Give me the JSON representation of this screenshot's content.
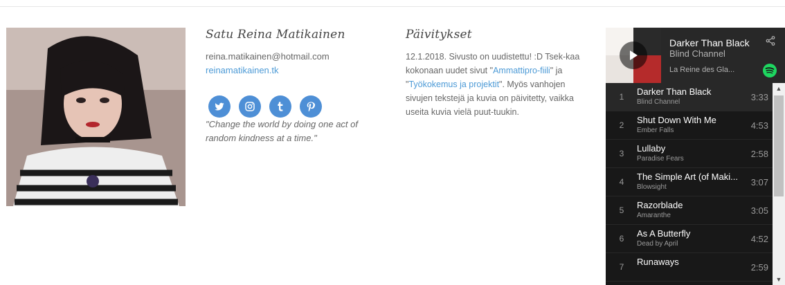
{
  "profile": {
    "name": "Satu Reina Matikainen",
    "email": "reina.matikainen@hotmail.com",
    "website": "reinamatikainen.tk",
    "quote": "\"Change the world by doing one act of random kindness at a time.\"",
    "social": [
      "twitter-icon",
      "instagram-icon",
      "tumblr-icon",
      "pinterest-icon"
    ]
  },
  "updates": {
    "title": "Päivitykset",
    "text_1": "12.1.2018. Sivusto on uudistettu! :D Tsek-kaa kokonaan uudet sivut \"",
    "link_1": "Ammattipro-fiili",
    "text_2": "\" ja \"",
    "link_2": "Työkokemus ja projektit",
    "text_3": "\". Myös vanhojen sivujen tekstejä ja kuvia on päivitetty, vaikka useita kuvia vielä puut-tuukin."
  },
  "spotify": {
    "now_title": "Darker Than Black",
    "now_artist": "Blind Channel",
    "album": "La Reine des Gla...",
    "tracks": [
      {
        "num": "1",
        "name": "Darker Than Black",
        "artist": "Blind Channel",
        "duration": "3:33"
      },
      {
        "num": "2",
        "name": "Shut Down With Me",
        "artist": "Ember Falls",
        "duration": "4:53"
      },
      {
        "num": "3",
        "name": "Lullaby",
        "artist": "Paradise Fears",
        "duration": "2:58"
      },
      {
        "num": "4",
        "name": "The Simple Art (of Maki...",
        "artist": "Blowsight",
        "duration": "3:07"
      },
      {
        "num": "5",
        "name": "Razorblade",
        "artist": "Amaranthe",
        "duration": "3:05"
      },
      {
        "num": "6",
        "name": "As A Butterfly",
        "artist": "Dead by April",
        "duration": "4:52"
      },
      {
        "num": "7",
        "name": "Runaways",
        "artist": "",
        "duration": "2:59"
      }
    ],
    "accent": "#1ed760"
  },
  "colors": {
    "link": "#4c9ad6",
    "social": "#4e8fd6"
  }
}
